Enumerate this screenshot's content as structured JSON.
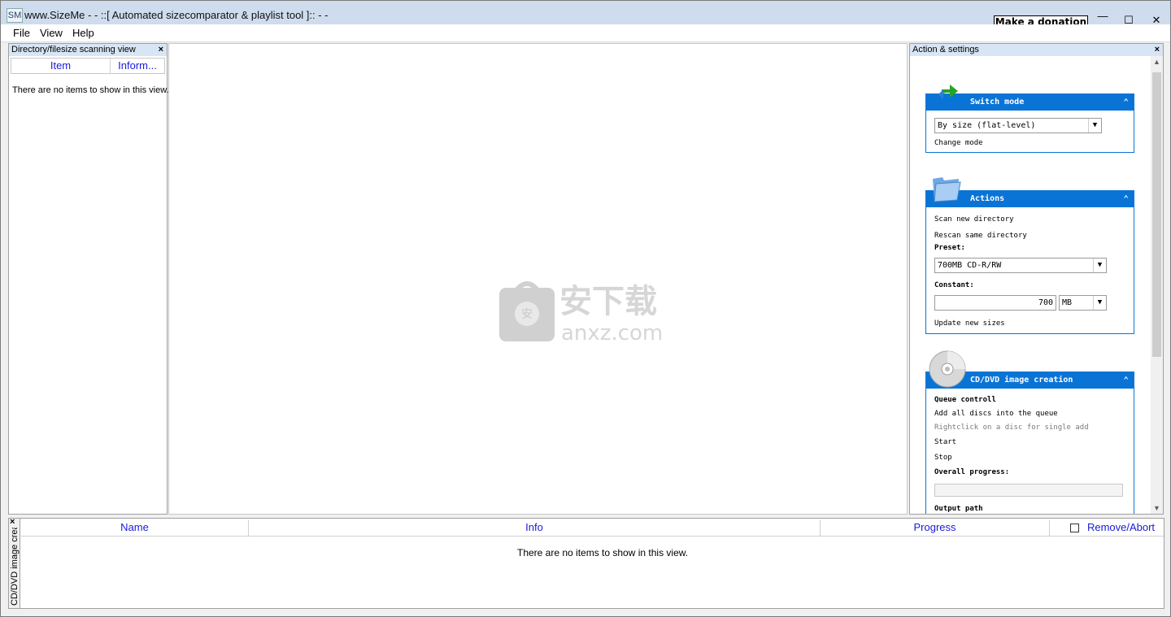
{
  "window": {
    "app_icon_text": "SM",
    "title": "www.SizeMe - - ::[ Automated sizecomparator & playlist tool ]:: - -",
    "donate_label": "Make a donation",
    "minimize": "—",
    "maximize": "☐",
    "close": "✕"
  },
  "menu": {
    "file": "File",
    "view": "View",
    "help": "Help"
  },
  "left_panel": {
    "caption": "Directory/filesize scanning view",
    "close": "×",
    "columns": [
      "Item",
      "Inform..."
    ],
    "empty_text": "There are no items to show in this view."
  },
  "right_panel": {
    "caption": "Action & settings",
    "close": "×",
    "switch_mode": {
      "title": "Switch mode",
      "collapse": "⌃",
      "mode_value": "By size (flat-level)",
      "change_mode": "Change mode"
    },
    "actions": {
      "title": "Actions",
      "collapse": "⌃",
      "scan_new": "Scan new directory",
      "rescan": "Rescan same directory",
      "preset_label": "Preset:",
      "preset_value": "700MB CD-R/RW",
      "constant_label": "Constant:",
      "constant_value": "700",
      "unit_value": "MB",
      "update_sizes": "Update new sizes"
    },
    "cd_dvd": {
      "title": "CD/DVD image creation",
      "collapse": "⌃",
      "queue_controll": "Queue controll",
      "add_all": "Add all discs into the queue",
      "rightclick_hint": "Rightclick on a disc for single add",
      "start": "Start",
      "stop": "Stop",
      "overall_progress": "Overall progress:",
      "output_path": "Output path"
    }
  },
  "bottom_panel": {
    "side_label": "CD/DVD image crea",
    "close": "×",
    "columns": [
      "Name",
      "Info",
      "Progress",
      "Remove/Abort"
    ],
    "empty_text": "There are no items to show in this view."
  },
  "watermark": {
    "cn_text": "安下载",
    "domain": "anxz.com"
  },
  "colors": {
    "accent_blue": "#0a74d6",
    "header_link_blue": "#1a1adb",
    "titlebar": "#cfdcee"
  }
}
